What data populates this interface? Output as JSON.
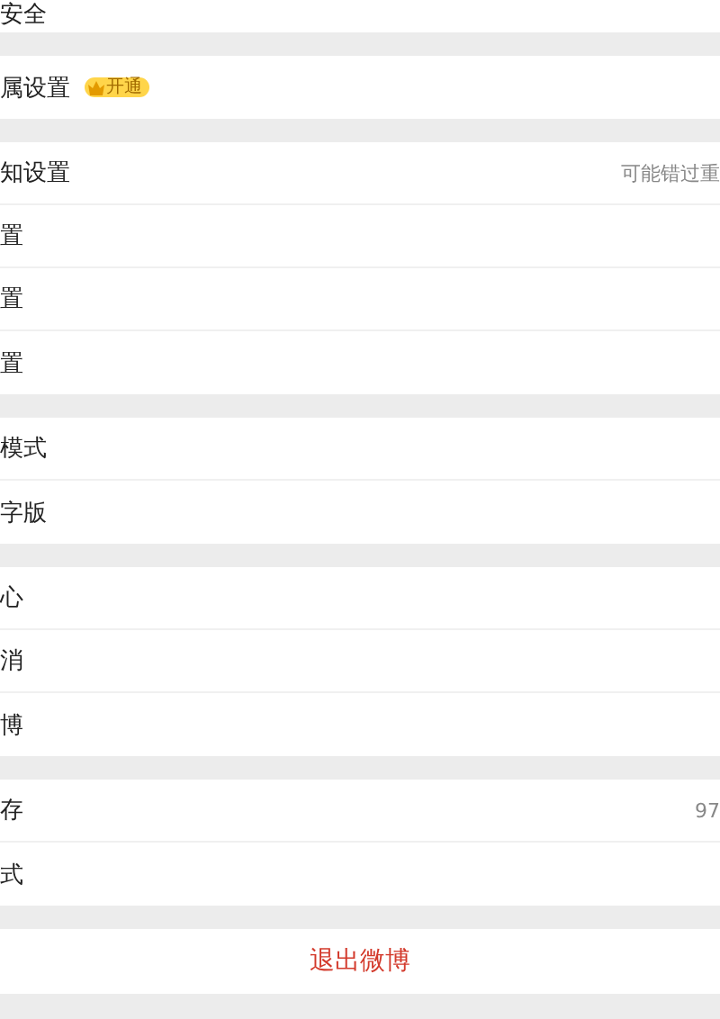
{
  "sections": [
    {
      "rows": [
        {
          "label": "安全"
        }
      ]
    },
    {
      "rows": [
        {
          "label": "属设置",
          "badge": "开通"
        }
      ]
    },
    {
      "rows": [
        {
          "label": "知设置",
          "value": "可能错过重"
        },
        {
          "label": "置"
        },
        {
          "label": "置"
        },
        {
          "label": "置"
        }
      ]
    },
    {
      "rows": [
        {
          "label": "模式"
        },
        {
          "label": "字版"
        }
      ]
    },
    {
      "rows": [
        {
          "label": "心"
        },
        {
          "label": "消"
        },
        {
          "label": "博"
        }
      ]
    },
    {
      "rows": [
        {
          "label": "存",
          "value": "97"
        },
        {
          "label": "式"
        }
      ]
    }
  ],
  "logout": "退出微博"
}
